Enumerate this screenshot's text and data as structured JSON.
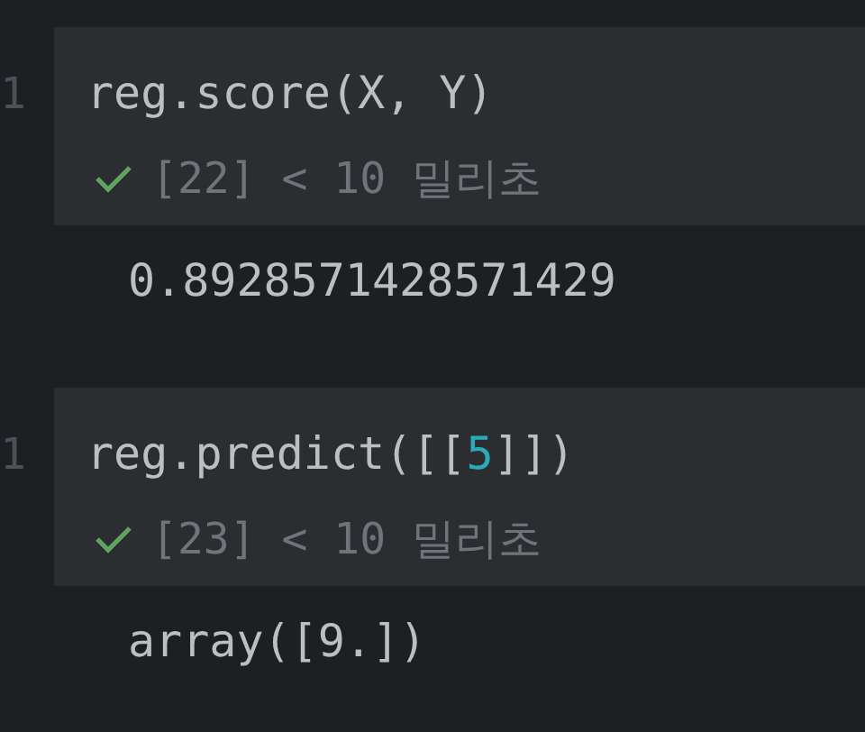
{
  "cells": [
    {
      "line_number": "1",
      "code": [
        {
          "text": "reg.score(X, Y)",
          "kind": "plain"
        }
      ],
      "status": {
        "succeeded": true,
        "text": "[22] < 10 밀리초"
      },
      "output": "0.8928571428571429"
    },
    {
      "line_number": "1",
      "code": [
        {
          "text": "reg.predict([[",
          "kind": "plain"
        },
        {
          "text": "5",
          "kind": "number"
        },
        {
          "text": "]])",
          "kind": "plain"
        }
      ],
      "status": {
        "succeeded": true,
        "text": "[23] < 10 밀리초"
      },
      "output": "array([9.])"
    }
  ]
}
